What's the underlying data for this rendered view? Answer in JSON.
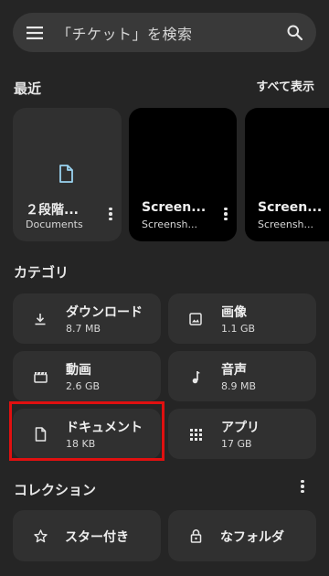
{
  "search": {
    "placeholder": "「チケット」を検索",
    "menu_icon": "hamburger-menu-icon",
    "search_icon": "search-icon"
  },
  "recent": {
    "title": "最近",
    "see_all": "すべて表示",
    "items": [
      {
        "name": "２段階...",
        "sub": "Documents",
        "icon": "document-icon"
      },
      {
        "name": "Screen...",
        "sub": "Screensh..."
      },
      {
        "name": "Screen...",
        "sub": "Screensh..."
      }
    ]
  },
  "categories": {
    "title": "カテゴリ",
    "items": [
      {
        "name": "ダウンロード",
        "size": "8.7 MB",
        "icon": "download-icon"
      },
      {
        "name": "画像",
        "size": "1.1 GB",
        "icon": "image-icon"
      },
      {
        "name": "動画",
        "size": "2.6 GB",
        "icon": "video-icon"
      },
      {
        "name": "音声",
        "size": "8.9 MB",
        "icon": "music-note-icon"
      },
      {
        "name": "ドキュメント",
        "size": "18 KB",
        "icon": "document-icon"
      },
      {
        "name": "アプリ",
        "size": "17 GB",
        "icon": "apps-grid-icon"
      }
    ],
    "highlight_color": "#e01010"
  },
  "collections": {
    "title": "コレクション",
    "items": [
      {
        "name": "スター付き",
        "icon": "star-outline-icon"
      },
      {
        "name": "なフォルダ",
        "icon": "lock-icon"
      }
    ]
  }
}
